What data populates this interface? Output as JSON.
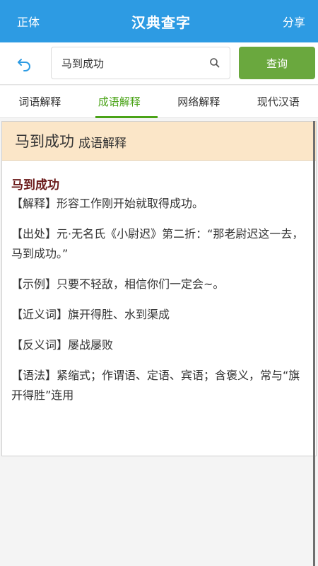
{
  "header": {
    "left": "正体",
    "title": "汉典查字",
    "right": "分享"
  },
  "search": {
    "value": "马到成功",
    "button": "查询"
  },
  "tabs": [
    "词语解释",
    "成语解释",
    "网络解释",
    "现代汉语"
  ],
  "active_tab": "成语解释",
  "card": {
    "word": "马到成功",
    "subtitle": "成语解释",
    "entry_title": "马到成功",
    "paragraphs": [
      "【解释】形容工作刚开始就取得成功。",
      "【出处】元·无名氏《小尉迟》第二折：“那老尉迟这一去，马到成功。”",
      "【示例】只要不轻敌，相信你们一定会~。",
      "【近义词】旗开得胜、水到渠成",
      "【反义词】屡战屡败",
      "【语法】紧缩式；作谓语、定语、宾语；含褒义，常与“旗开得胜”连用"
    ]
  },
  "colors": {
    "header": "#2d9be3",
    "button": "#6aa83e",
    "active_tab": "#4aa317",
    "card_header": "#fbe6c8",
    "entry_title": "#6b1a1a"
  }
}
